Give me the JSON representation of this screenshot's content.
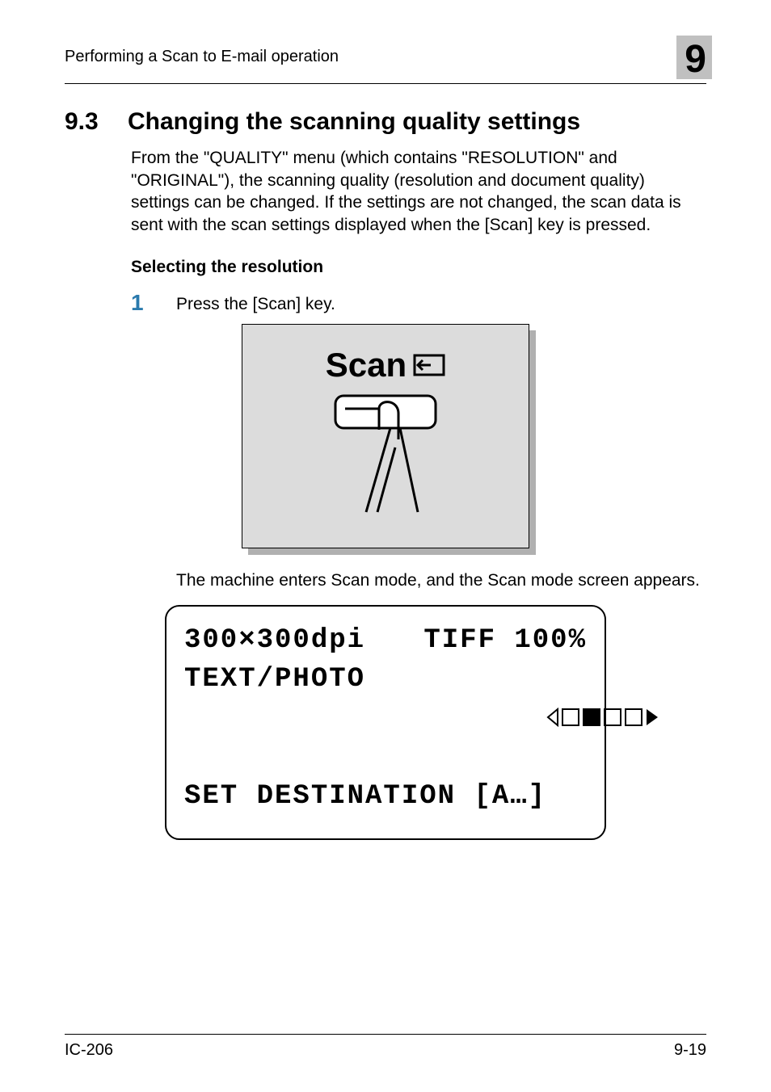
{
  "header": {
    "breadcrumb": "Performing a Scan to E-mail operation",
    "chapter_number": "9"
  },
  "section": {
    "number": "9.3",
    "title": "Changing the scanning quality settings",
    "intro": "From the \"QUALITY\" menu (which contains \"RESOLUTION\" and \"ORIGINAL\"), the scanning quality (resolution and document quality) settings can be changed. If the settings are not changed, the scan data is sent with the scan settings displayed when the [Scan] key is pressed."
  },
  "subsection": {
    "heading": "Selecting the resolution"
  },
  "steps": [
    {
      "num": "1",
      "text": "Press the [Scan] key."
    }
  ],
  "illustration": {
    "label": "Scan"
  },
  "result_line": "The machine enters Scan mode, and the Scan mode screen appears.",
  "lcd": {
    "line1_left": "300×300dpi",
    "line1_right": "TIFF 100%",
    "line2_left": "TEXT/PHOTO",
    "line3": "SET DESTINATION [A…]"
  },
  "footer": {
    "left": "IC-206",
    "right": "9-19"
  }
}
